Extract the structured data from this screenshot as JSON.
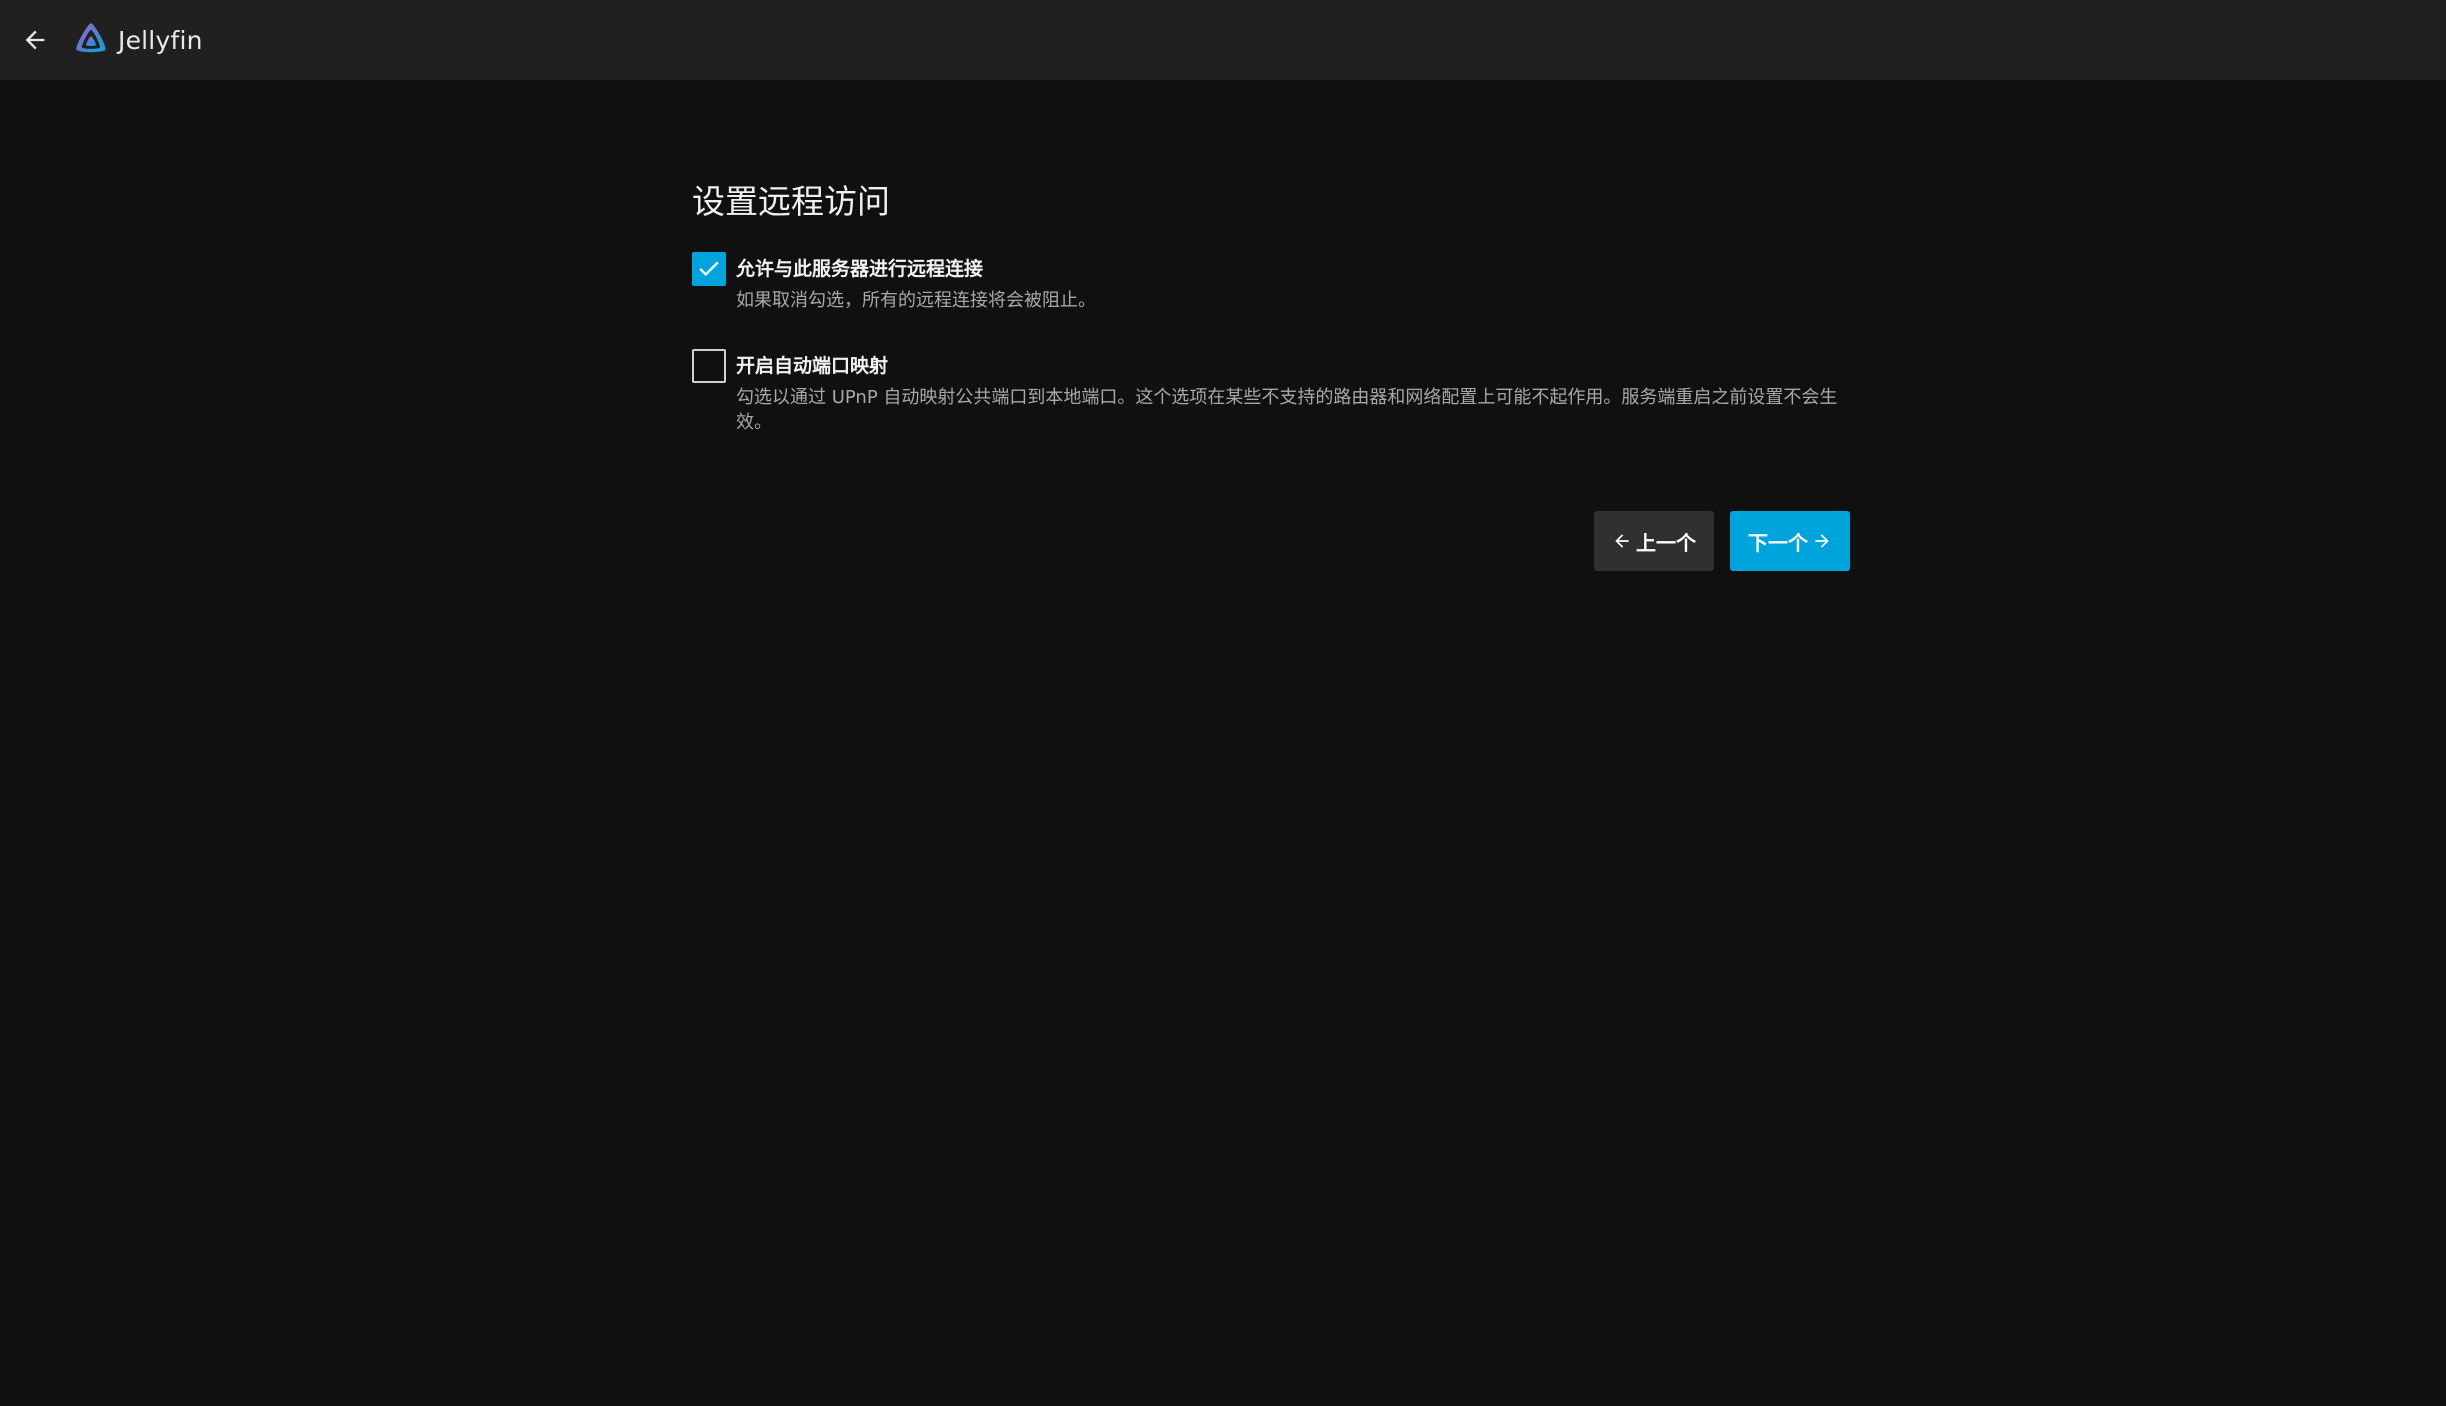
{
  "header": {
    "app_name": "Jellyfin",
    "back_icon": "arrow-left-icon",
    "logo_icon": "jellyfin-logo-icon"
  },
  "wizard": {
    "title": "设置远程访问",
    "options": [
      {
        "label": "允许与此服务器进行远程连接",
        "description": "如果取消勾选，所有的远程连接将会被阻止。",
        "checked": true
      },
      {
        "label": "开启自动端口映射",
        "description": "勾选以通过 UPnP 自动映射公共端口到本地端口。这个选项在某些不支持的路由器和网络配置上可能不起作用。服务端重启之前设置不会生效。",
        "checked": false
      }
    ],
    "buttons": {
      "previous": "上一个",
      "next": "下一个"
    }
  },
  "colors": {
    "accent": "#00a4dc",
    "background": "#101010",
    "header": "#202020",
    "secondary_button": "#303030"
  }
}
